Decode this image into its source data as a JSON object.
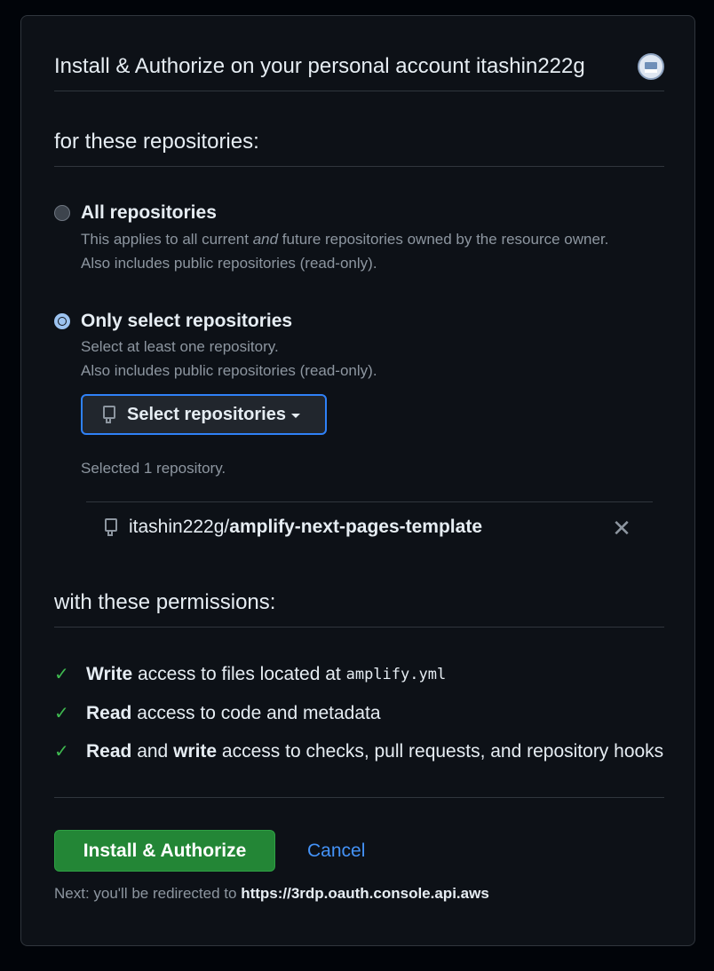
{
  "header": {
    "title": "Install & Authorize on your personal account itashin222g"
  },
  "repositories_section": {
    "title": "for these repositories:",
    "options": [
      {
        "label": "All repositories",
        "desc_pre": "This applies to all current ",
        "desc_em": "and",
        "desc_post": " future repositories owned by the resource owner.",
        "desc_line2": "Also includes public repositories (read-only).",
        "selected": false
      },
      {
        "label": "Only select repositories",
        "desc_line1": "Select at least one repository.",
        "desc_line2": "Also includes public repositories (read-only).",
        "selected": true
      }
    ],
    "select_button_label": "Select repositories",
    "selected_count": "Selected 1 repository.",
    "repo": {
      "owner": "itashin222g/",
      "name": "amplify-next-pages-template"
    }
  },
  "permissions_section": {
    "title": "with these permissions:",
    "items": [
      {
        "bold1": "Write",
        "text1": " access to files located at ",
        "code": "amplify.yml"
      },
      {
        "bold1": "Read",
        "text1": " access to code and metadata"
      },
      {
        "bold1": "Read",
        "text1": " and ",
        "bold2": "write",
        "text2": " access to checks, pull requests, and repository hooks"
      }
    ]
  },
  "actions": {
    "install_label": "Install & Authorize",
    "cancel_label": "Cancel",
    "next_prefix": "Next: you'll be redirected to ",
    "next_url": "https://3rdp.oauth.console.api.aws"
  },
  "colors": {
    "accent_blue": "#2f81f7",
    "install_green": "#238636",
    "check_green": "#3fb950"
  },
  "icons": [
    "repo-icon",
    "check-icon",
    "close-icon",
    "caret-down-icon",
    "avatar"
  ]
}
